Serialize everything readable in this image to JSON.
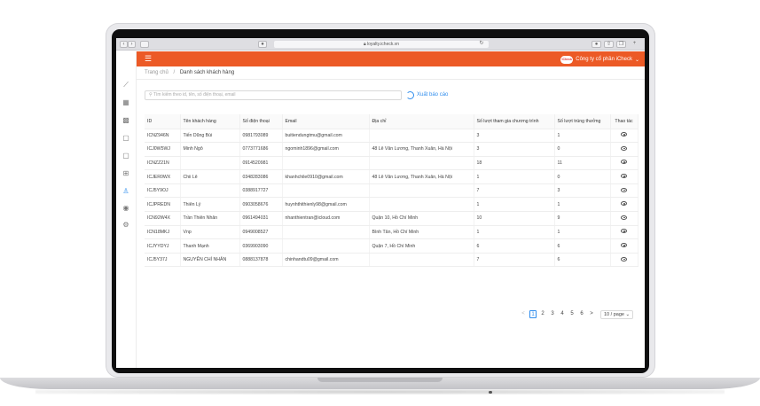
{
  "browser": {
    "url": "loyalty.icheck.vn"
  },
  "header": {
    "company": "Công ty cổ phần iCheck",
    "logo_text": "iCheck"
  },
  "breadcrumb": {
    "home": "Trang chủ",
    "sep": "/",
    "current": "Danh sách khách hàng"
  },
  "toolbar": {
    "search_placeholder": "Tìm kiếm theo id, tên, số điện thoại, email",
    "export_label": "Xuất báo cáo"
  },
  "table": {
    "columns": [
      "ID",
      "Tên khách hàng",
      "Số điện thoại",
      "Email",
      "Địa chỉ",
      "Số lượt tham gia chương trình",
      "Số lượt trúng thưởng",
      "Thao tác"
    ],
    "rows": [
      [
        "ICNZ946N",
        "Tiến Dũng Bùi",
        "0981793089",
        "buitiendungtmu@gmail.com",
        "",
        "3",
        "1"
      ],
      [
        "ICJ0W5WJ",
        "Minh Ngô",
        "0773771686",
        "ngominh1896@gmail.com",
        "48 Lê Văn Lương, Thanh Xuân, Hà Nội",
        "3",
        "0"
      ],
      [
        "ICNZZ21N",
        "",
        "0914520981",
        "",
        "",
        "18",
        "11"
      ],
      [
        "ICJER0WX",
        "Chii Lê",
        "0348283086",
        "khanhchile0910@gmail.com",
        "48 Lê Văn Lương, Thanh Xuân, Hà Nội",
        "1",
        "0"
      ],
      [
        "ICJ5Y9OJ",
        "",
        "0388917727",
        "",
        "",
        "7",
        "3"
      ],
      [
        "ICJPREDN",
        "Thiên Lý",
        "0903058676",
        "huynhthithienly98@gmail.com",
        "",
        "1",
        "1"
      ],
      [
        "ICN92W4X",
        "Trần Thiên Nhân",
        "0961494031",
        "nhanthientran@icloud.com",
        "Quận 10, Hồ Chí Minh",
        "10",
        "9"
      ],
      [
        "ICN18MKJ",
        "Vnp",
        "0949008527",
        "",
        "Bình Tân, Hồ Chí Minh",
        "1",
        "1"
      ],
      [
        "ICJYYDYJ",
        "Thanh Mạnh",
        "0369903090",
        "",
        "Quận 7, Hồ Chí Minh",
        "6",
        "6"
      ],
      [
        "ICJ5Y37J",
        "NGUYỄN CHÍ NHÂN",
        "0888137878",
        "chinhandtu09@gmail.com",
        "",
        "7",
        "6"
      ]
    ]
  },
  "pagination": {
    "prev": "<",
    "next": ">",
    "pages": [
      "1",
      "2",
      "3",
      "4",
      "5",
      "6"
    ],
    "active": "1",
    "page_size": "10 / page"
  },
  "colors": {
    "brand": "#ec5a26",
    "accent": "#2f8ded"
  }
}
